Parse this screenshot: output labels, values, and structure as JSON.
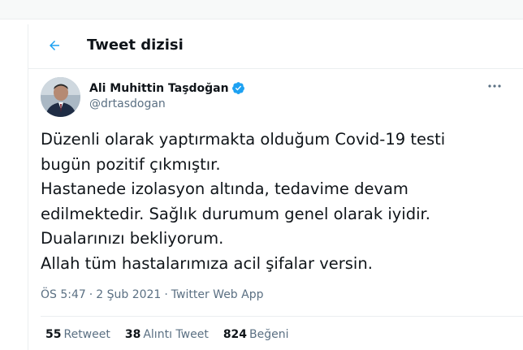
{
  "header": {
    "title": "Tweet dizisi",
    "back_icon": "arrow-left-icon",
    "accent_color": "#1da1f2"
  },
  "tweet": {
    "author_name": "Ali Muhittin Taşdoğan",
    "handle": "@drtasdogan",
    "verified": true,
    "text_lines": [
      "Düzenli olarak yaptırmakta olduğum Covid-19 testi",
      "bugün pozitif çıkmıştır.",
      "Hastanede izolasyon altında, tedavime devam",
      "edilmektedir. Sağlık durumum genel olarak iyidir.",
      "Dualarınızı bekliyorum.",
      "Allah tüm hastalarımıza acil şifalar versin."
    ],
    "time": "ÖS 5:47",
    "date": "2 Şub 2021",
    "source": "Twitter Web App",
    "separator": "·"
  },
  "stats": {
    "retweets": {
      "count": "55",
      "label": "Retweet"
    },
    "quotes": {
      "count": "38",
      "label": "Alıntı Tweet"
    },
    "likes": {
      "count": "824",
      "label": "Beğeni"
    }
  }
}
